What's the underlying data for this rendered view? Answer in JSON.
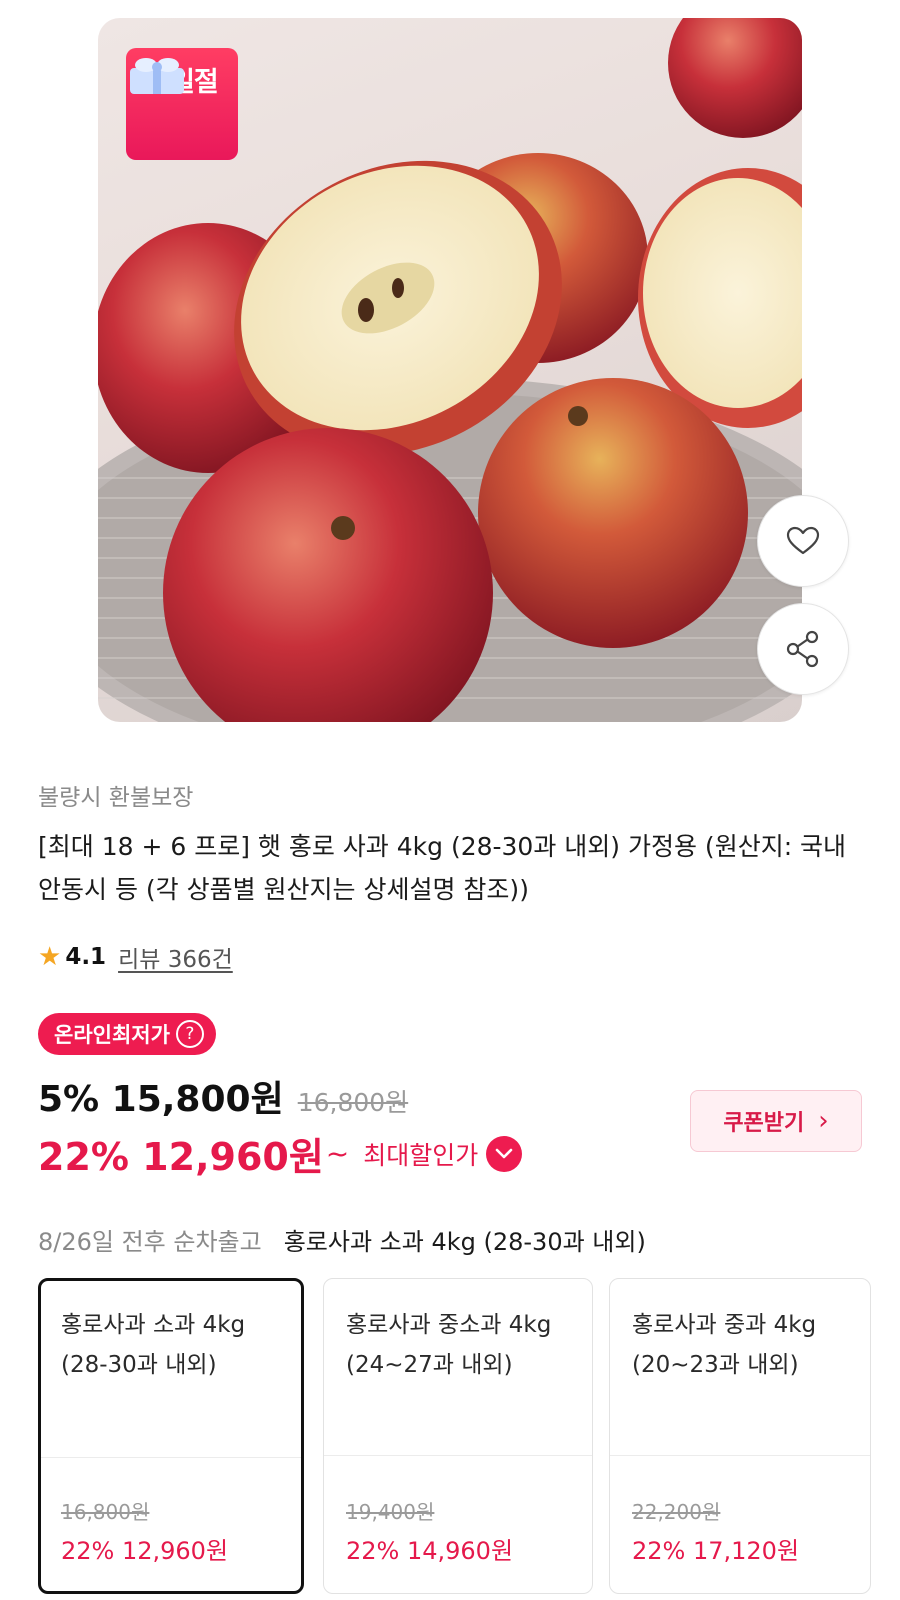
{
  "product_image": {
    "alt": "apples",
    "badge_text": "십일절"
  },
  "actions": {
    "wish_icon": "heart-icon",
    "share_icon": "share-icon"
  },
  "guarantee": "불량시 환불보장",
  "title": "[최대 18 + 6 프로] 햇 홍로 사과 4kg (28-30과 내외) 가정용 (원산지: 국내안동시 등 (각 상품별 원산지는 상세설명 참조))",
  "rating": {
    "score": "4.1",
    "review_text": "리뷰 366건"
  },
  "price": {
    "lowest_badge": "온라인최저가",
    "line1_main": "5% 15,800원",
    "line1_original": "16,800원",
    "line2_main": "22% 12,960원",
    "line2_suffix": "~",
    "line2_label": "최대할인가"
  },
  "coupon": {
    "label": "쿠폰받기",
    "arrow": "›"
  },
  "shipping": {
    "text": "8/26일 전후 순차출고",
    "selected_option": "홍로사과 소과 4kg (28-30과 내외)"
  },
  "options": [
    {
      "name": "홍로사과 소과 4kg (28-30과 내외)",
      "original": "16,800원",
      "sale": "22% 12,960원",
      "selected": true
    },
    {
      "name": "홍로사과 중소과 4kg (24~27과 내외)",
      "original": "19,400원",
      "sale": "22% 14,960원",
      "selected": false
    },
    {
      "name": "홍로사과 중과 4kg (20~23과 내외)",
      "original": "22,200원",
      "sale": "22% 17,120원",
      "selected": false
    }
  ],
  "colors": {
    "accent": "#e5194b",
    "badge": "#ee1c50",
    "star": "#f5a623"
  }
}
